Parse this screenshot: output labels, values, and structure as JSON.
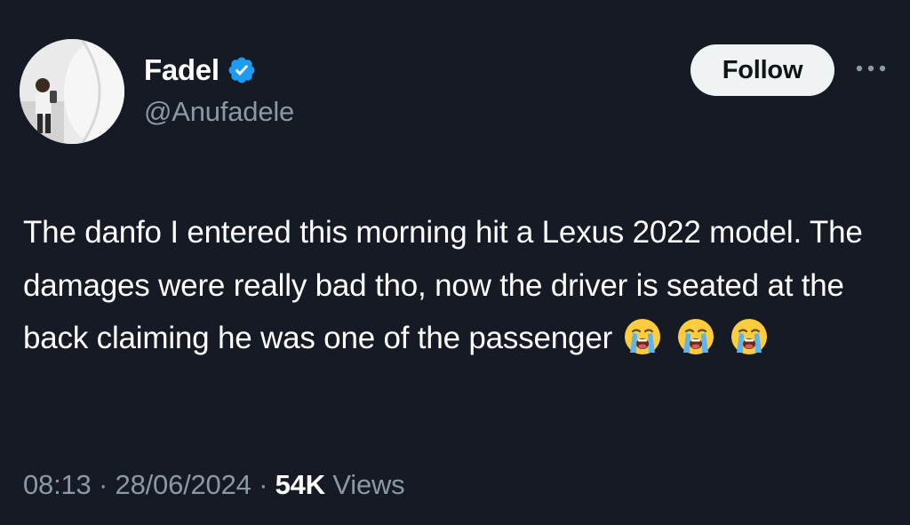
{
  "author": {
    "display_name": "Fadel",
    "handle": "@Anufadele",
    "verified": true,
    "verified_color": "#1d9bf0"
  },
  "actions": {
    "follow_label": "Follow",
    "more_icon": "more-horizontal-icon"
  },
  "tweet": {
    "text": "The danfo I entered this morning hit a Lexus 2022 model. The damages were really bad tho, now the driver is seated at the back claiming he was one of the passenger",
    "emojis": [
      "loudly-crying-face",
      "loudly-crying-face",
      "loudly-crying-face"
    ]
  },
  "meta": {
    "time": "08:13",
    "separator": " · ",
    "date": "28/06/2024",
    "views_count": "54K",
    "views_label": " Views"
  },
  "colors": {
    "background": "#151a24",
    "text_primary": "#ffffff",
    "text_secondary": "#8b98a5",
    "button_bg": "#eff3f4"
  }
}
